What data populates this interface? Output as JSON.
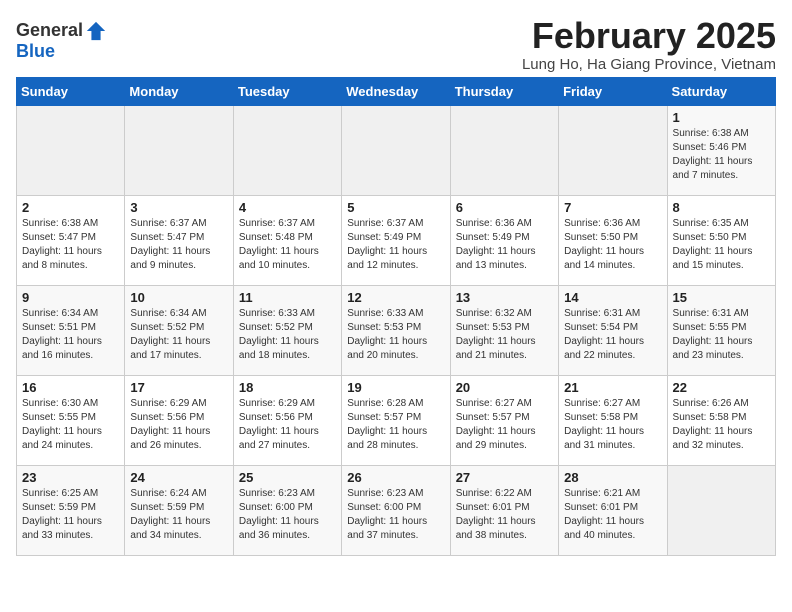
{
  "header": {
    "logo_general": "General",
    "logo_blue": "Blue",
    "title": "February 2025",
    "subtitle": "Lung Ho, Ha Giang Province, Vietnam"
  },
  "days_of_week": [
    "Sunday",
    "Monday",
    "Tuesday",
    "Wednesday",
    "Thursday",
    "Friday",
    "Saturday"
  ],
  "weeks": [
    [
      {
        "day": "",
        "info": ""
      },
      {
        "day": "",
        "info": ""
      },
      {
        "day": "",
        "info": ""
      },
      {
        "day": "",
        "info": ""
      },
      {
        "day": "",
        "info": ""
      },
      {
        "day": "",
        "info": ""
      },
      {
        "day": "1",
        "info": "Sunrise: 6:38 AM\nSunset: 5:46 PM\nDaylight: 11 hours and 7 minutes."
      }
    ],
    [
      {
        "day": "2",
        "info": "Sunrise: 6:38 AM\nSunset: 5:47 PM\nDaylight: 11 hours and 8 minutes."
      },
      {
        "day": "3",
        "info": "Sunrise: 6:37 AM\nSunset: 5:47 PM\nDaylight: 11 hours and 9 minutes."
      },
      {
        "day": "4",
        "info": "Sunrise: 6:37 AM\nSunset: 5:48 PM\nDaylight: 11 hours and 10 minutes."
      },
      {
        "day": "5",
        "info": "Sunrise: 6:37 AM\nSunset: 5:49 PM\nDaylight: 11 hours and 12 minutes."
      },
      {
        "day": "6",
        "info": "Sunrise: 6:36 AM\nSunset: 5:49 PM\nDaylight: 11 hours and 13 minutes."
      },
      {
        "day": "7",
        "info": "Sunrise: 6:36 AM\nSunset: 5:50 PM\nDaylight: 11 hours and 14 minutes."
      },
      {
        "day": "8",
        "info": "Sunrise: 6:35 AM\nSunset: 5:50 PM\nDaylight: 11 hours and 15 minutes."
      }
    ],
    [
      {
        "day": "9",
        "info": "Sunrise: 6:34 AM\nSunset: 5:51 PM\nDaylight: 11 hours and 16 minutes."
      },
      {
        "day": "10",
        "info": "Sunrise: 6:34 AM\nSunset: 5:52 PM\nDaylight: 11 hours and 17 minutes."
      },
      {
        "day": "11",
        "info": "Sunrise: 6:33 AM\nSunset: 5:52 PM\nDaylight: 11 hours and 18 minutes."
      },
      {
        "day": "12",
        "info": "Sunrise: 6:33 AM\nSunset: 5:53 PM\nDaylight: 11 hours and 20 minutes."
      },
      {
        "day": "13",
        "info": "Sunrise: 6:32 AM\nSunset: 5:53 PM\nDaylight: 11 hours and 21 minutes."
      },
      {
        "day": "14",
        "info": "Sunrise: 6:31 AM\nSunset: 5:54 PM\nDaylight: 11 hours and 22 minutes."
      },
      {
        "day": "15",
        "info": "Sunrise: 6:31 AM\nSunset: 5:55 PM\nDaylight: 11 hours and 23 minutes."
      }
    ],
    [
      {
        "day": "16",
        "info": "Sunrise: 6:30 AM\nSunset: 5:55 PM\nDaylight: 11 hours and 24 minutes."
      },
      {
        "day": "17",
        "info": "Sunrise: 6:29 AM\nSunset: 5:56 PM\nDaylight: 11 hours and 26 minutes."
      },
      {
        "day": "18",
        "info": "Sunrise: 6:29 AM\nSunset: 5:56 PM\nDaylight: 11 hours and 27 minutes."
      },
      {
        "day": "19",
        "info": "Sunrise: 6:28 AM\nSunset: 5:57 PM\nDaylight: 11 hours and 28 minutes."
      },
      {
        "day": "20",
        "info": "Sunrise: 6:27 AM\nSunset: 5:57 PM\nDaylight: 11 hours and 29 minutes."
      },
      {
        "day": "21",
        "info": "Sunrise: 6:27 AM\nSunset: 5:58 PM\nDaylight: 11 hours and 31 minutes."
      },
      {
        "day": "22",
        "info": "Sunrise: 6:26 AM\nSunset: 5:58 PM\nDaylight: 11 hours and 32 minutes."
      }
    ],
    [
      {
        "day": "23",
        "info": "Sunrise: 6:25 AM\nSunset: 5:59 PM\nDaylight: 11 hours and 33 minutes."
      },
      {
        "day": "24",
        "info": "Sunrise: 6:24 AM\nSunset: 5:59 PM\nDaylight: 11 hours and 34 minutes."
      },
      {
        "day": "25",
        "info": "Sunrise: 6:23 AM\nSunset: 6:00 PM\nDaylight: 11 hours and 36 minutes."
      },
      {
        "day": "26",
        "info": "Sunrise: 6:23 AM\nSunset: 6:00 PM\nDaylight: 11 hours and 37 minutes."
      },
      {
        "day": "27",
        "info": "Sunrise: 6:22 AM\nSunset: 6:01 PM\nDaylight: 11 hours and 38 minutes."
      },
      {
        "day": "28",
        "info": "Sunrise: 6:21 AM\nSunset: 6:01 PM\nDaylight: 11 hours and 40 minutes."
      },
      {
        "day": "",
        "info": ""
      }
    ]
  ]
}
